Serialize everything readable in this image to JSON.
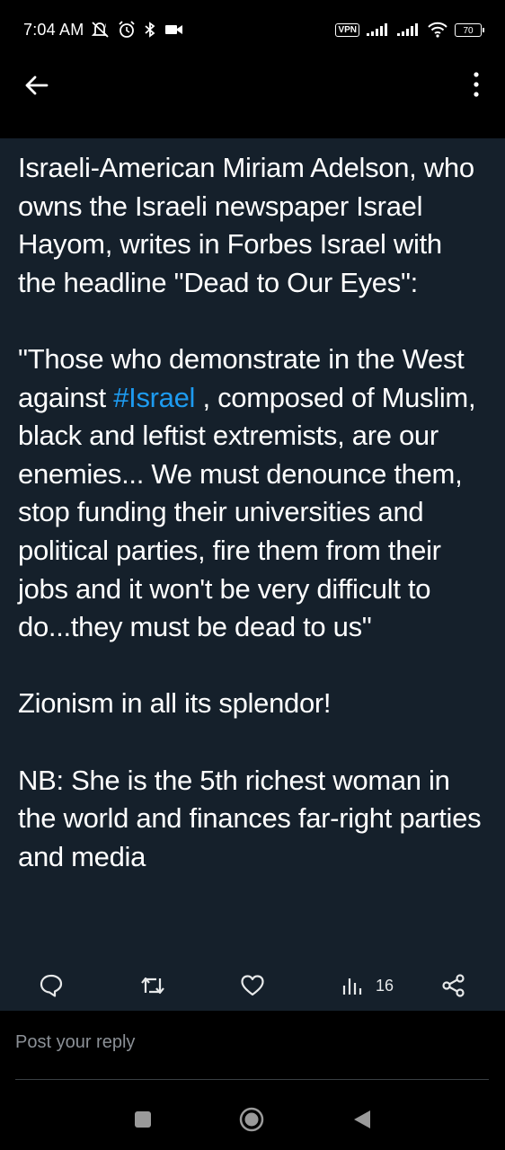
{
  "status_bar": {
    "time": "7:04 AM",
    "vpn": "VPN",
    "battery": "70",
    "icons": [
      "mute-icon",
      "alarm-icon",
      "bluetooth-icon",
      "video-icon",
      "signal-icon",
      "signal-icon",
      "wifi-icon",
      "battery-icon"
    ]
  },
  "header": {
    "back_icon": "arrow-left-icon",
    "more_icon": "more-vertical-icon"
  },
  "tweet": {
    "para1": "Israeli-American Miriam Adelson, who owns the Israeli newspaper Israel Hayom, writes in Forbes Israel with the headline \"Dead to Our Eyes\":",
    "para2_before": "\"Those who demonstrate in the West against ",
    "hashtag": "#Israel",
    "para2_after": " , composed of Muslim, black and leftist extremists, are our enemies... We must denounce them, stop funding their universities and political parties, fire them from their jobs and it won't be very difficult to do...they must be dead to us\"",
    "para3": "Zionism in all its splendor!",
    "para4": "NB: She is the 5th richest woman in the world and finances far-right parties and media",
    "hashtag_color": "#1d9bf0"
  },
  "actions": {
    "reply_icon": "reply-icon",
    "retweet_icon": "retweet-icon",
    "like_icon": "heart-icon",
    "views_icon": "views-icon",
    "views_count": "16",
    "share_icon": "share-icon"
  },
  "reply": {
    "placeholder": "Post your reply"
  },
  "nav": {
    "icons": [
      "recents-icon",
      "home-icon",
      "back-icon"
    ]
  }
}
